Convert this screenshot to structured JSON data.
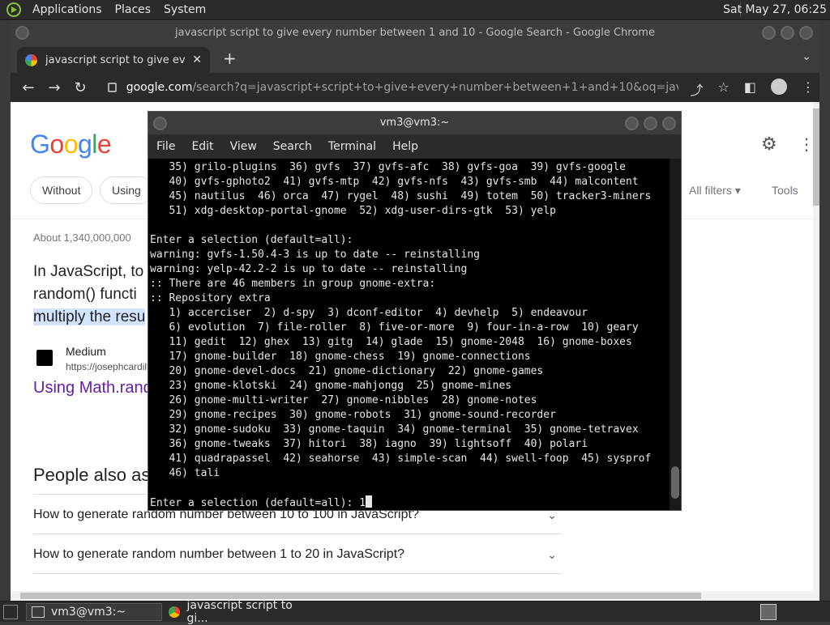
{
  "top_panel": {
    "menus": [
      "Applications",
      "Places",
      "System"
    ],
    "clock": "Sat May 27, 06:25"
  },
  "chrome": {
    "window_title": "javascript script to give every number between 1 and 10 - Google Search - Google Chrome",
    "tab_title": "javascript script to give every n",
    "url_host": "google.com",
    "url_path": "/search?q=javascript+script+to+give+every+number+between+1+and+10&oq=javascript+script+t..."
  },
  "google": {
    "logo": [
      "G",
      "o",
      "o",
      "g",
      "l",
      "e"
    ],
    "chips": [
      "Without",
      "Using"
    ],
    "all_filters": "All filters",
    "tools": "Tools",
    "about": "About 1,340,000,000",
    "snippet_lines": [
      "In JavaScript, to",
      "random() functi",
      "multiply the resu"
    ],
    "source_name": "Medium",
    "source_url": "https://josephcardill",
    "result_link": "Using Math.rand",
    "paa_title": "People also as",
    "paa_items": [
      "How to generate random number between 10 to 100 in JavaScript?",
      "How to generate random number between 1 to 20 in JavaScript?"
    ]
  },
  "terminal": {
    "title": "vm3@vm3:~",
    "menu": [
      "File",
      "Edit",
      "View",
      "Search",
      "Terminal",
      "Help"
    ],
    "lines": [
      "   35) grilo-plugins  36) gvfs  37) gvfs-afc  38) gvfs-goa  39) gvfs-google",
      "   40) gvfs-gphoto2  41) gvfs-mtp  42) gvfs-nfs  43) gvfs-smb  44) malcontent",
      "   45) nautilus  46) orca  47) rygel  48) sushi  49) totem  50) tracker3-miners",
      "   51) xdg-desktop-portal-gnome  52) xdg-user-dirs-gtk  53) yelp",
      "",
      "Enter a selection (default=all):",
      "warning: gvfs-1.50.4-3 is up to date -- reinstalling",
      "warning: yelp-42.2-2 is up to date -- reinstalling",
      ":: There are 46 members in group gnome-extra:",
      ":: Repository extra",
      "   1) accerciser  2) d-spy  3) dconf-editor  4) devhelp  5) endeavour",
      "   6) evolution  7) file-roller  8) five-or-more  9) four-in-a-row  10) geary",
      "   11) gedit  12) ghex  13) gitg  14) glade  15) gnome-2048  16) gnome-boxes",
      "   17) gnome-builder  18) gnome-chess  19) gnome-connections",
      "   20) gnome-devel-docs  21) gnome-dictionary  22) gnome-games",
      "   23) gnome-klotski  24) gnome-mahjongg  25) gnome-mines",
      "   26) gnome-multi-writer  27) gnome-nibbles  28) gnome-notes",
      "   29) gnome-recipes  30) gnome-robots  31) gnome-sound-recorder",
      "   32) gnome-sudoku  33) gnome-taquin  34) gnome-terminal  35) gnome-tetravex",
      "   36) gnome-tweaks  37) hitori  38) iagno  39) lightsoff  40) polari",
      "   41) quadrapassel  42) seahorse  43) simple-scan  44) swell-foop  45) sysprof",
      "   46) tali",
      ""
    ],
    "prompt": "Enter a selection (default=all): 1"
  },
  "taskbar": {
    "items": [
      "vm3@vm3:~",
      "javascript script to gi..."
    ]
  }
}
